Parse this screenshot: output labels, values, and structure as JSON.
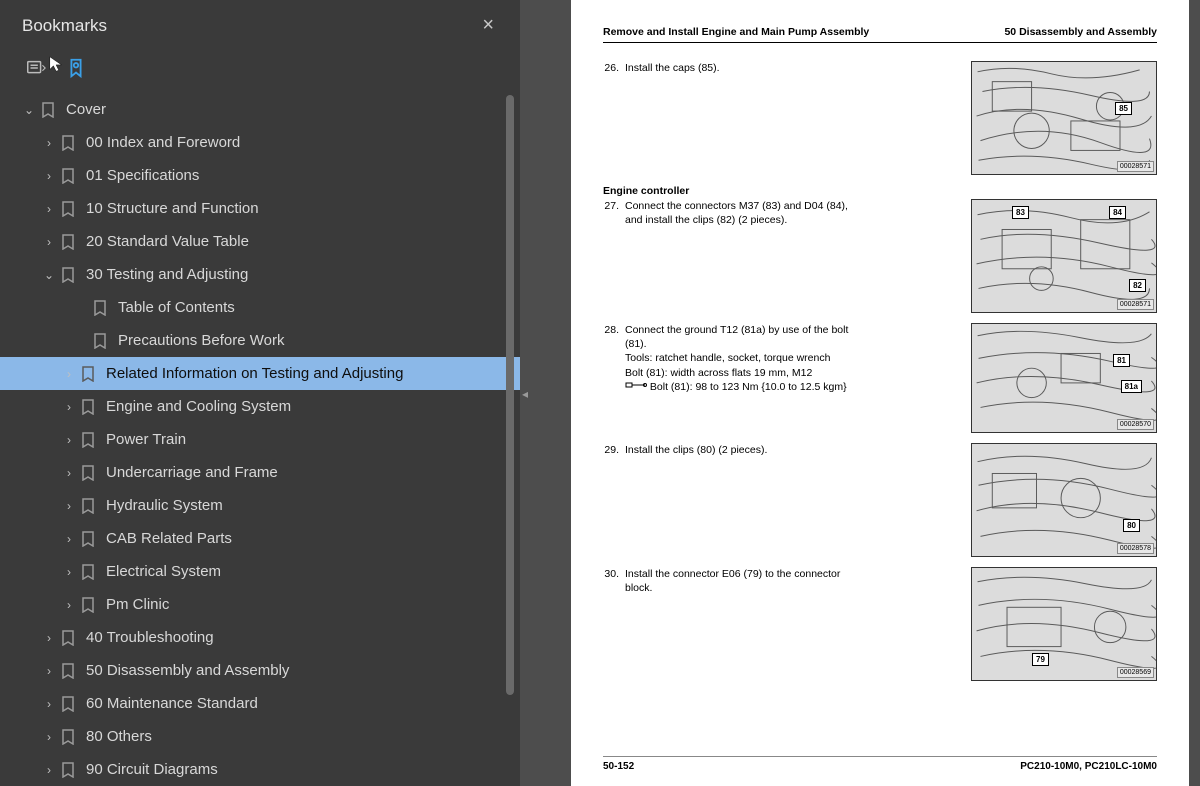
{
  "sidebar": {
    "title": "Bookmarks",
    "tree": {
      "root": "Cover",
      "s00": "00 Index and Foreword",
      "s01": "01 Specifications",
      "s10": "10 Structure and Function",
      "s20": "20 Standard Value Table",
      "s30": "30 Testing and Adjusting",
      "s30_toc": "Table of Contents",
      "s30_prec": "Precautions Before Work",
      "s30_rel": "Related Information on Testing and Adjusting",
      "s30_eng": "Engine and Cooling System",
      "s30_pow": "Power Train",
      "s30_und": "Undercarriage and Frame",
      "s30_hyd": "Hydraulic System",
      "s30_cab": "CAB Related Parts",
      "s30_ele": "Electrical System",
      "s30_pm": "Pm Clinic",
      "s40": "40 Troubleshooting",
      "s50": "50 Disassembly and Assembly",
      "s60": "60 Maintenance Standard",
      "s80": "80 Others",
      "s90": "90 Circuit Diagrams"
    }
  },
  "page": {
    "header_left": "Remove and Install Engine and Main Pump Assembly",
    "header_right": "50 Disassembly and Assembly",
    "subhead_engine": "Engine controller",
    "steps": {
      "n26": "26.",
      "t26": "Install the caps (85).",
      "n27": "27.",
      "t27": "Connect the connectors M37 (83) and D04 (84), and install the clips (82) (2 pieces).",
      "n28": "28.",
      "t28a": "Connect the ground T12 (81a) by use of the bolt (81).",
      "t28b": "Tools: ratchet handle, socket, torque wrench",
      "t28c": "Bolt (81): width across flats 19 mm, M12",
      "t28d": "Bolt (81): 98 to 123 Nm {10.0 to 12.5 kgm}",
      "n29": "29.",
      "t29": "Install the clips (80) (2 pieces).",
      "n30": "30.",
      "t30": "Install the connector E06 (79) to the connector block."
    },
    "callouts": {
      "c85": "85",
      "c83": "83",
      "c84": "84",
      "c82": "82",
      "c81": "81",
      "c81a": "81a",
      "c80": "80",
      "c79": "79"
    },
    "figids": {
      "f1": "00028571",
      "f2": "00028571",
      "f3": "00028570",
      "f4": "00028578",
      "f5": "00028569"
    },
    "footer_left": "50-152",
    "footer_right": "PC210-10M0, PC210LC-10M0"
  }
}
